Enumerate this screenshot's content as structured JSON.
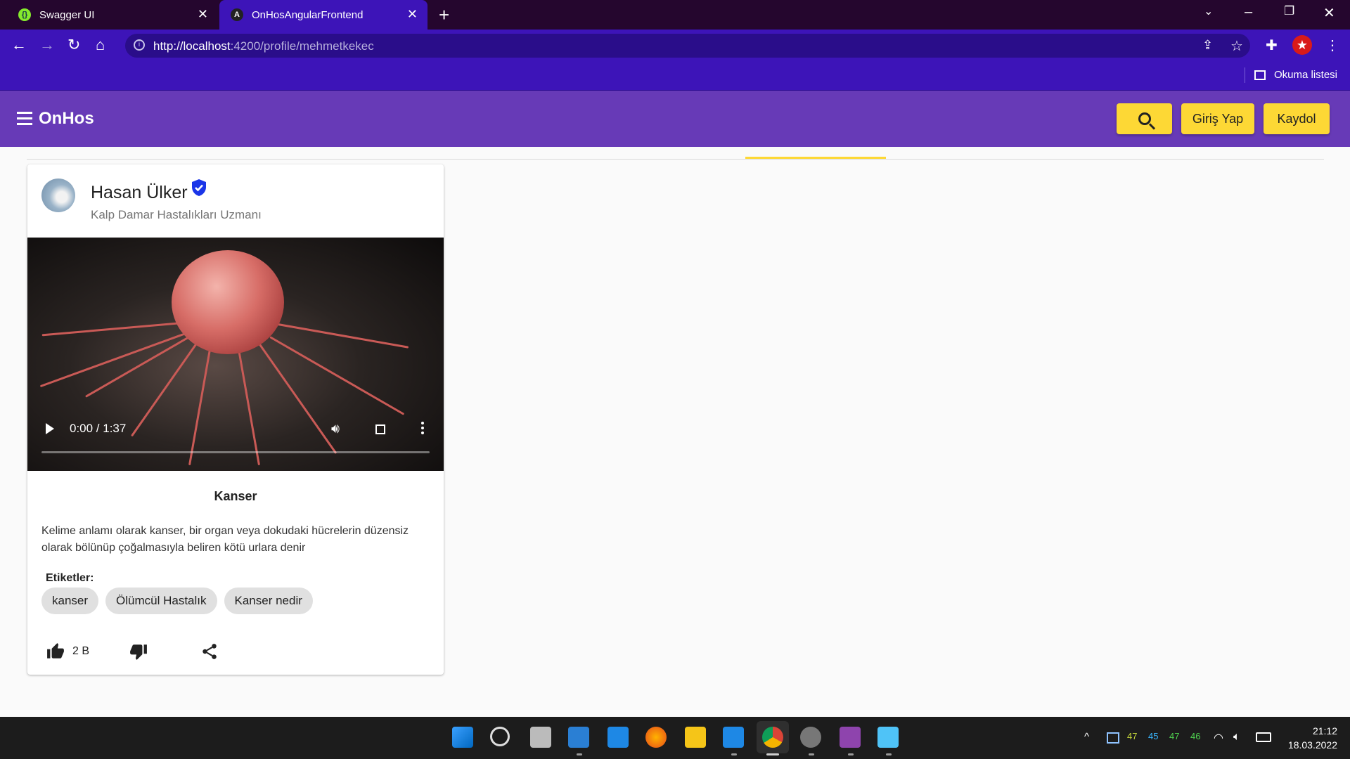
{
  "browser": {
    "tabs": [
      {
        "title": "Swagger UI",
        "active": false
      },
      {
        "title": "OnHosAngularFrontend",
        "active": true
      }
    ],
    "url_host": "http://localhost",
    "url_rest": ":4200/profile/mehmetkekec",
    "reading_list": "Okuma listesi"
  },
  "app": {
    "brand": "OnHos",
    "login_label": "Giriş Yap",
    "signup_label": "Kaydol",
    "accent": "#673ab7",
    "button_color": "#fdd835"
  },
  "post": {
    "author_name": "Hasan Ülker",
    "author_title": "Kalp Damar Hastalıkları Uzmanı",
    "verified": true,
    "video_time": "0:00 / 1:37",
    "title": "Kanser",
    "body": "Kelime anlamı olarak kanser, bir organ veya dokudaki hücrelerin düzensiz olarak bölünüp çoğalmasıyla beliren kötü urlara denir",
    "tags_label": "Etiketler:",
    "tags": [
      "kanser",
      "Ölümcül Hastalık",
      "Kanser nedir"
    ],
    "like_count": "2 B"
  },
  "taskbar": {
    "tray_numbers": [
      "47",
      "45",
      "47",
      "46"
    ],
    "time": "21:12",
    "date": "18.03.2022"
  }
}
